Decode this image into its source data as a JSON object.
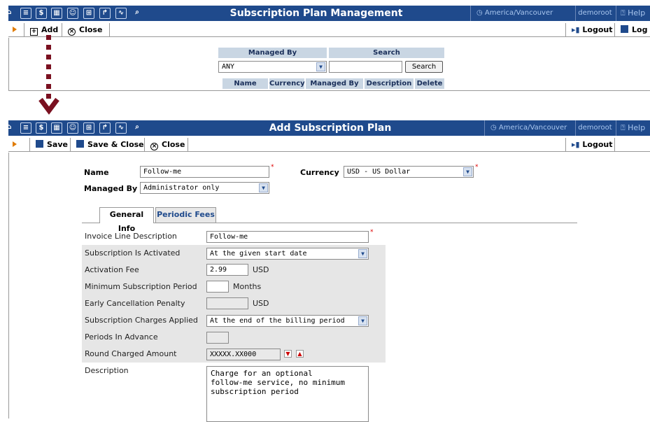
{
  "top_window": {
    "title": "Subscription Plan Management",
    "timezone": "America/Vancouver",
    "user": "demoroot",
    "help": "Help",
    "toolbar": {
      "add": "Add",
      "close": "Close",
      "logout": "Logout",
      "log": "Log"
    },
    "search": {
      "managed_by_header": "Managed By",
      "search_header": "Search",
      "managed_by_value": "ANY",
      "search_value": "",
      "search_button": "Search",
      "columns": [
        "Name",
        "Currency",
        "Managed By",
        "Description",
        "Delete"
      ]
    }
  },
  "bottom_window": {
    "title": "Add Subscription Plan",
    "timezone": "America/Vancouver",
    "user": "demoroot",
    "help": "Help",
    "toolbar": {
      "save": "Save",
      "save_close": "Save & Close",
      "close": "Close",
      "logout": "Logout"
    },
    "form": {
      "name_label": "Name",
      "name_value": "Follow-me",
      "currency_label": "Currency",
      "currency_value": "USD - US Dollar",
      "managed_by_label": "Managed By",
      "managed_by_value": "Administrator only",
      "required_mark": "*"
    },
    "tabs": [
      "General Info",
      "Periodic Fees"
    ],
    "general": {
      "invoice_line_label": "Invoice Line Description",
      "invoice_line_value": "Follow-me",
      "activated_label": "Subscription Is Activated",
      "activated_value": "At the given start date",
      "activation_fee_label": "Activation Fee",
      "activation_fee_value": "2.99",
      "usd": "USD",
      "min_period_label": "Minimum Subscription Period",
      "min_period_value": "",
      "months": "Months",
      "early_cancel_label": "Early Cancellation Penalty",
      "early_cancel_value": "",
      "charges_applied_label": "Subscription Charges Applied",
      "charges_applied_value": "At the end of the billing period",
      "periods_advance_label": "Periods In Advance",
      "periods_advance_value": "",
      "round_label": "Round Charged Amount",
      "round_value": "XXXXX.XX000",
      "description_label": "Description",
      "description_value": "Charge for an optional\nfollow-me service, no minimum\nsubscription period"
    },
    "icons": [
      "home-icon",
      "list-icon",
      "dollar-icon",
      "grid-icon",
      "person-icon",
      "network-icon",
      "export-icon",
      "chart-icon",
      "zoom-icon"
    ]
  }
}
